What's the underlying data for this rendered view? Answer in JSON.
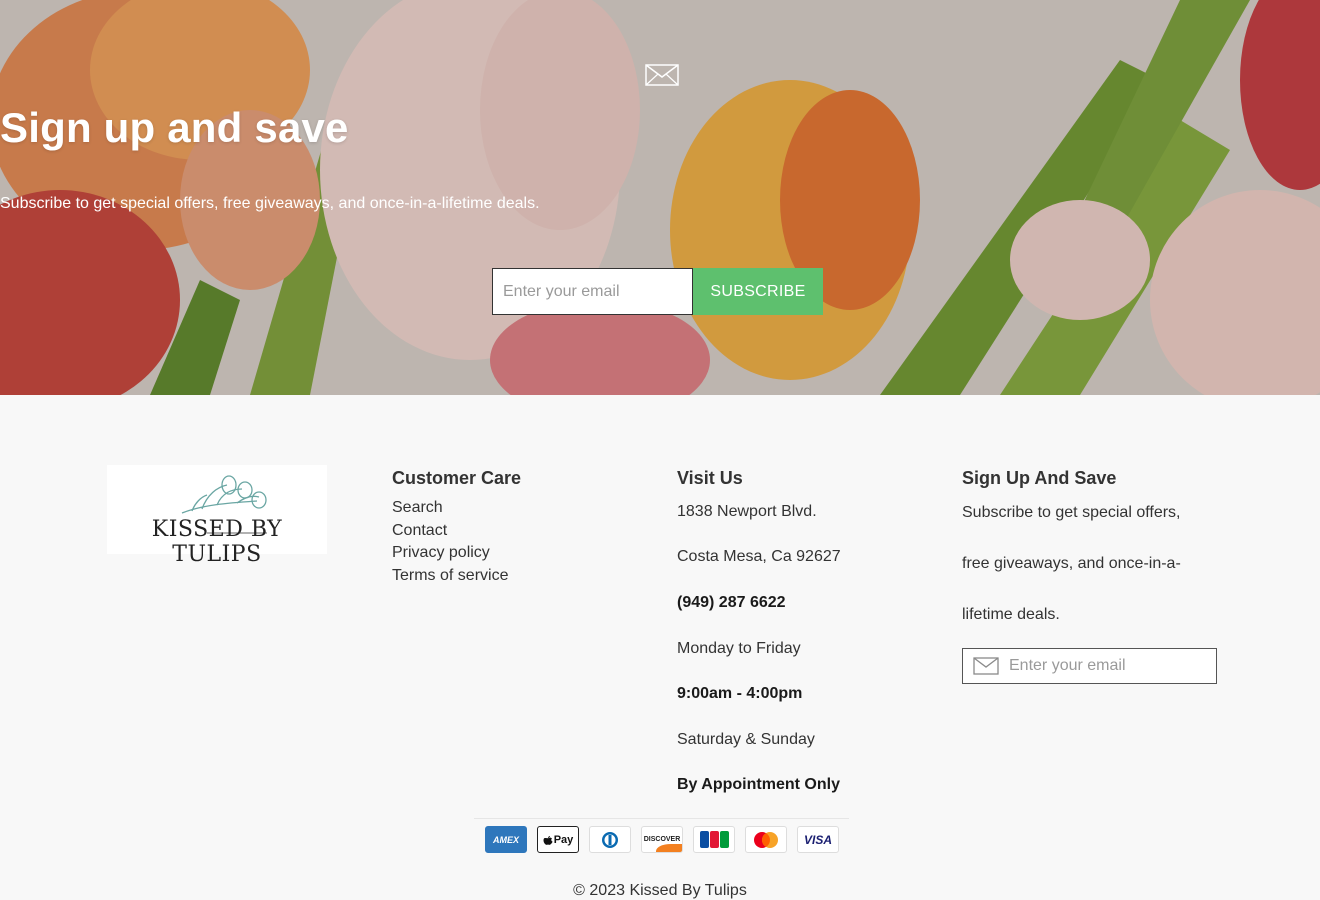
{
  "hero": {
    "title": "Sign up and save",
    "subtitle": "Subscribe to get special offers, free giveaways, and once-in-a-lifetime deals.",
    "email_placeholder": "Enter your email",
    "subscribe_label": "SUBSCRIBE",
    "accent_color": "#5ec06e"
  },
  "logo": {
    "text": "Kissed By Tulips"
  },
  "customer_care": {
    "heading": "Customer Care",
    "links": [
      "Search",
      "Contact",
      "Privacy policy",
      "Terms of service"
    ]
  },
  "visit": {
    "heading": "Visit Us",
    "address1": "1838 Newport Blvd.",
    "address2": "Costa Mesa, Ca 92627",
    "phone": "(949) 287 6622",
    "weekdays": "Monday to Friday",
    "weekday_hours": "9:00am - 4:00pm",
    "weekend": "Saturday & Sunday",
    "weekend_hours": "By Appointment Only"
  },
  "signup": {
    "heading": "Sign Up And Save",
    "lines": [
      "Subscribe to get special offers,",
      "free giveaways, and once-in-a-",
      "lifetime deals."
    ],
    "email_placeholder": "Enter your email"
  },
  "payments": [
    {
      "name": "American Express",
      "icon": "amex-icon",
      "label": "AMEX"
    },
    {
      "name": "Apple Pay",
      "icon": "apple-pay-icon",
      "label": "Pay"
    },
    {
      "name": "Diners Club",
      "icon": "diners-club-icon",
      "label": ""
    },
    {
      "name": "Discover",
      "icon": "discover-icon",
      "label": "DISCOVER"
    },
    {
      "name": "JCB",
      "icon": "jcb-icon",
      "label": "JCB"
    },
    {
      "name": "Mastercard",
      "icon": "mastercard-icon",
      "label": ""
    },
    {
      "name": "Visa",
      "icon": "visa-icon",
      "label": "VISA"
    }
  ],
  "copyright": "© 2023 Kissed By Tulips"
}
